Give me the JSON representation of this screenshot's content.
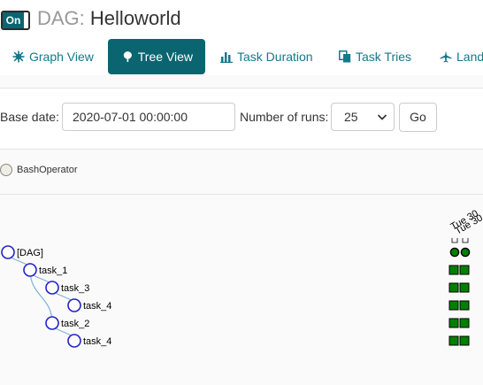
{
  "header": {
    "toggle_label": "On",
    "title_prefix": "DAG:",
    "dag_name": "Helloworld"
  },
  "tabs": [
    {
      "label": "Graph View",
      "icon": "graph-icon",
      "active": false
    },
    {
      "label": "Tree View",
      "icon": "tree-icon",
      "active": true
    },
    {
      "label": "Task Duration",
      "icon": "bar-chart-icon",
      "active": false
    },
    {
      "label": "Task Tries",
      "icon": "duplicate-icon",
      "active": false
    },
    {
      "label": "Land",
      "icon": "plane-icon",
      "active": false
    }
  ],
  "filters": {
    "base_date_label": "Base date:",
    "base_date_value": "2020-07-01 00:00:00",
    "runs_label": "Number of runs:",
    "runs_value": "25",
    "go_label": "Go"
  },
  "legend": {
    "operator": "BashOperator",
    "operator_color": "#f0ede4"
  },
  "tree": {
    "run_header": "Tue 30",
    "nodes": [
      {
        "label": "[DAG]",
        "depth": 0
      },
      {
        "label": "task_1",
        "depth": 1
      },
      {
        "label": "task_3",
        "depth": 2
      },
      {
        "label": "task_4",
        "depth": 3
      },
      {
        "label": "task_2",
        "depth": 2
      },
      {
        "label": "task_4",
        "depth": 3
      }
    ],
    "success_color": "#008000"
  }
}
